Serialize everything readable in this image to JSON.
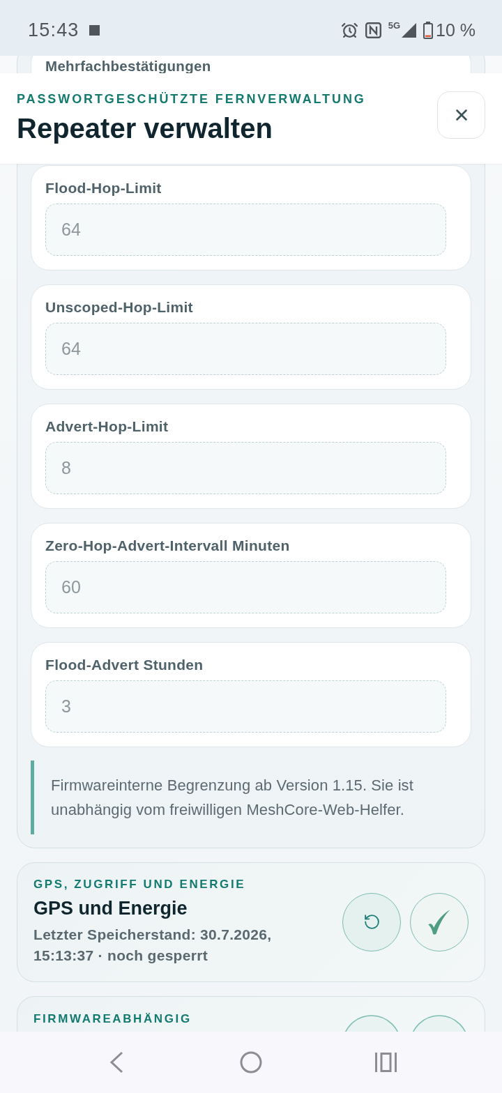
{
  "status_bar": {
    "time": "15:43",
    "network": "5G",
    "battery": "10 %"
  },
  "header": {
    "eyebrow": "PASSWORTGESCHÜTZTE FERNVERWALTUNG",
    "title": "Repeater verwalten"
  },
  "section": {
    "covered_field_label": "Mehrfachbestätigungen",
    "fields": [
      {
        "label": "Flood-Hop-Limit",
        "value": "64",
        "disabled": true
      },
      {
        "label": "Unscoped-Hop-Limit",
        "value": "64",
        "disabled": true
      },
      {
        "label": "Advert-Hop-Limit",
        "value": "8",
        "disabled": true
      },
      {
        "label": "Zero-Hop-Advert-Intervall Minuten",
        "value": "60",
        "disabled": true
      },
      {
        "label": "Flood-Advert Stunden",
        "value": "3",
        "disabled": true
      }
    ],
    "note": "Firmwareinterne Begrenzung ab Version 1.15. Sie ist unabhängig vom freiwilligen MeshCore-Web-Helfer."
  },
  "cards": [
    {
      "eyebrow": "GPS, ZUGRIFF UND ENERGIE",
      "title": "GPS und Energie",
      "status": "Letzter Speicherstand: 30.7.2026, 15:13:37 · noch gesperrt"
    },
    {
      "eyebrow": "FIRMWAREABHÄNGIG"
    }
  ]
}
